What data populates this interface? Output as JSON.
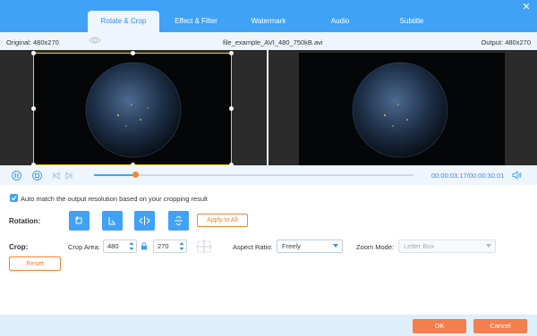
{
  "tabs": [
    {
      "label": "Rotate & Crop",
      "active": true
    },
    {
      "label": "Effect & Filter"
    },
    {
      "label": "Watermark"
    },
    {
      "label": "Audio"
    },
    {
      "label": "Subtitle"
    }
  ],
  "window": {
    "close_icon": "close-icon"
  },
  "info": {
    "original": "Original: 480x270",
    "file_name": "file_example_AVI_480_750kB.avi",
    "output": "Output: 480x270"
  },
  "playback": {
    "current_time": "00:00:03.17",
    "total_time": "/00:00:30.01",
    "progress_fraction": 0.13
  },
  "options": {
    "auto_match_checked": true,
    "auto_match_label": "Auto match the output resolution based on your cropping result",
    "rotation_label": "Rotation:",
    "apply_to_all": "Apply to All",
    "crop_label": "Crop:",
    "crop_area_label": "Crop Area:",
    "crop_width": "480",
    "crop_height": "270",
    "aspect_ratio_label": "Aspect Ratio:",
    "aspect_ratio_value": "Freely",
    "zoom_mode_label": "Zoom Mode:",
    "zoom_mode_value": "Letter Box",
    "reset": "Reset"
  },
  "footer": {
    "ok": "OK",
    "cancel": "Cancel"
  },
  "colors": {
    "accent": "#3fa2f6",
    "orange": "#f5852b",
    "crop_border": "#f4d400"
  }
}
